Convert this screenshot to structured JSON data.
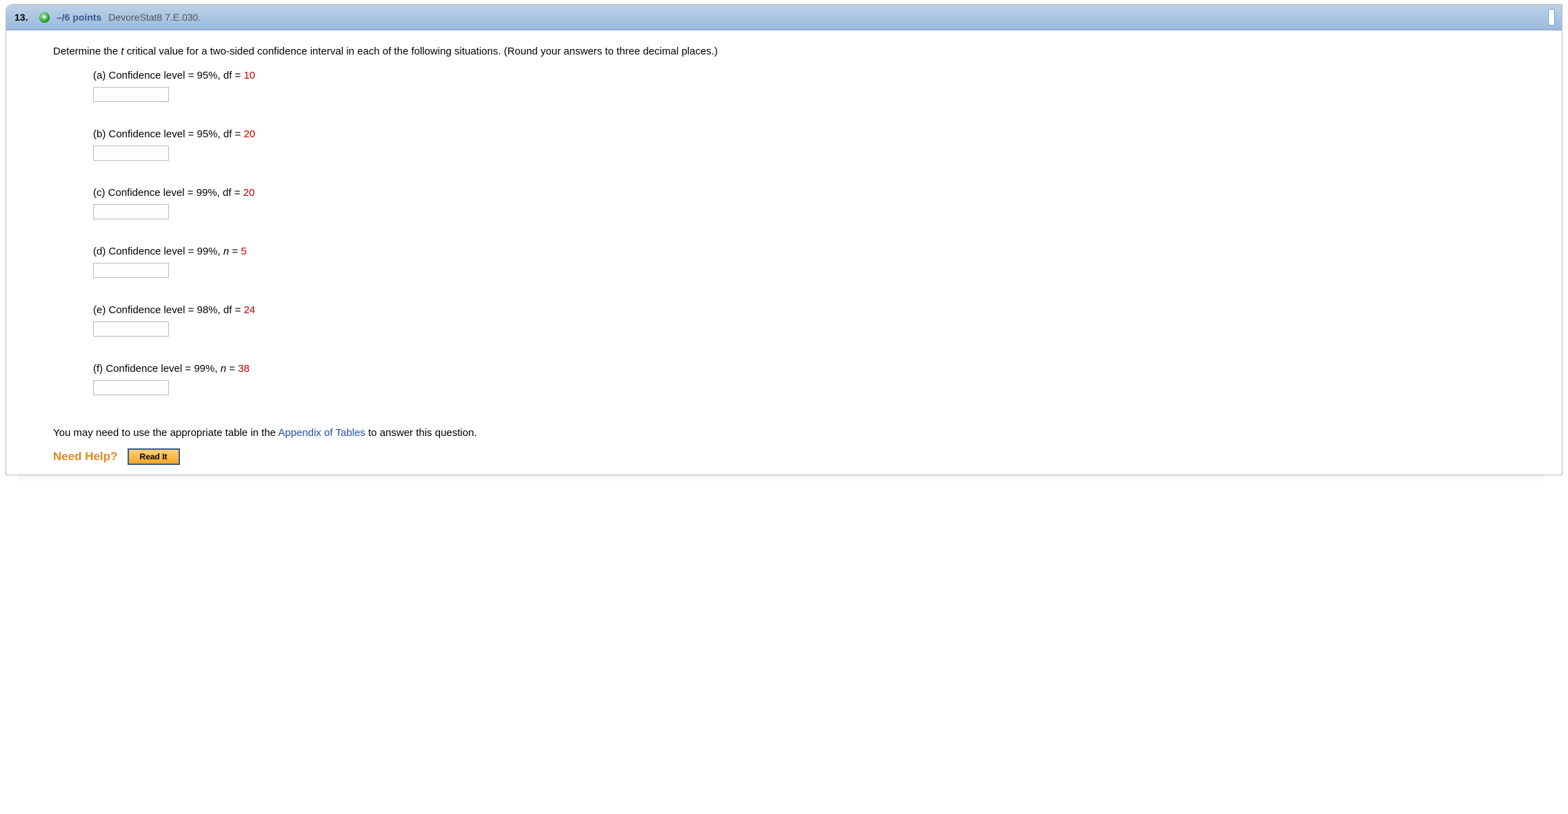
{
  "header": {
    "number": "13.",
    "points": "–/6 points",
    "source": "DevoreStat8 7.E.030."
  },
  "prompt": {
    "pre": "Determine the ",
    "tvar": "t",
    "post": " critical value for a two-sided confidence interval in each of the following situations. (Round your answers to three decimal places.)"
  },
  "parts": [
    {
      "text": "(a) Confidence level = 95%, df = ",
      "value": "10",
      "answer": ""
    },
    {
      "text": "(b) Confidence level = 95%, df = ",
      "value": "20",
      "answer": ""
    },
    {
      "text": "(c) Confidence level = 99%, df = ",
      "value": "20",
      "answer": ""
    },
    {
      "text_pre": "(d) Confidence level = 99%, ",
      "nvar": "n",
      "text_post": " = ",
      "value": "5",
      "answer": ""
    },
    {
      "text": "(e) Confidence level = 98%, df = ",
      "value": "24",
      "answer": ""
    },
    {
      "text_pre": "(f) Confidence level = 99%, ",
      "nvar": "n",
      "text_post": " = ",
      "value": "38",
      "answer": ""
    }
  ],
  "appendix": {
    "pre": "You may need to use the appropriate table in the ",
    "link": "Appendix of Tables",
    "post": " to answer this question."
  },
  "help": {
    "label": "Need Help?",
    "read_label": "Read It"
  }
}
